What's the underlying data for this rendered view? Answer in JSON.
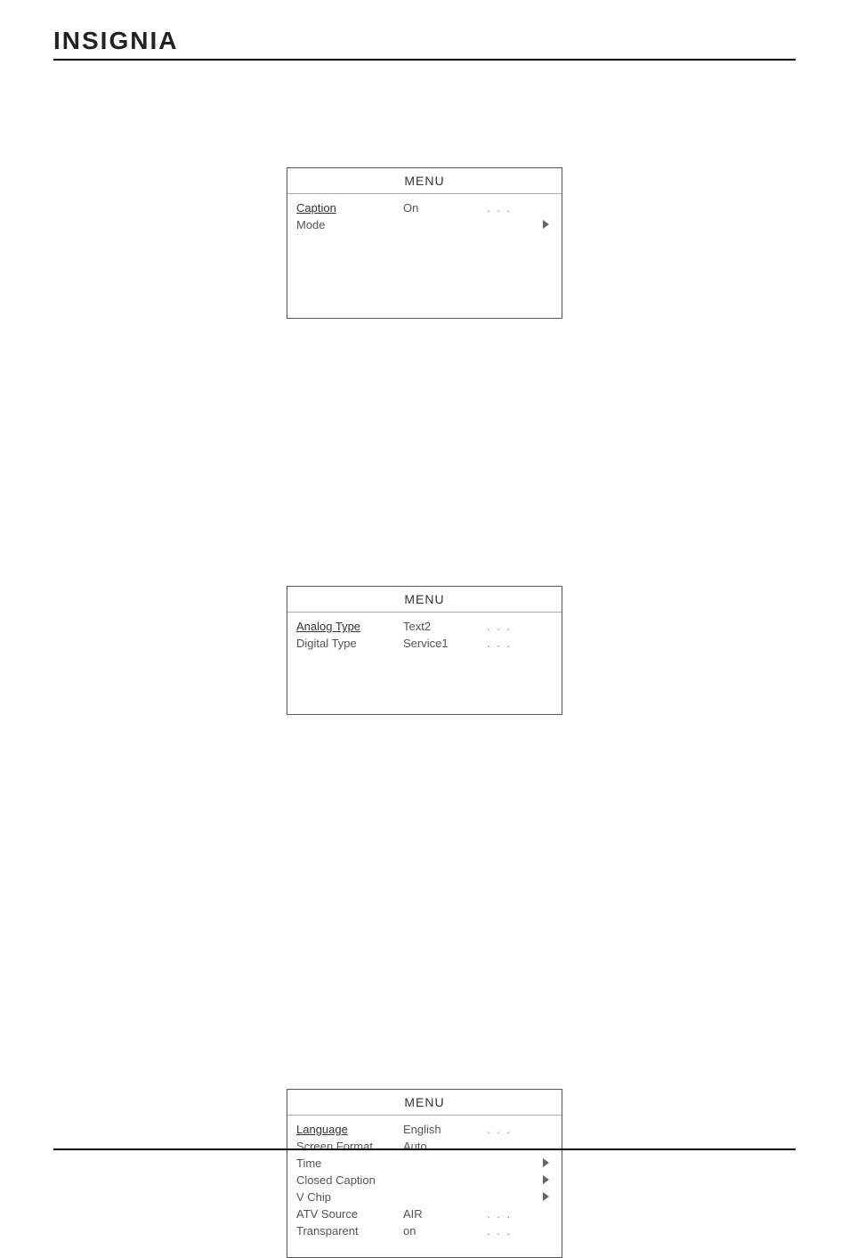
{
  "brand": "INSIGNIA",
  "menu1": {
    "title": "MENU",
    "rows": [
      {
        "label": "Caption",
        "value": "On",
        "dots": ". . .",
        "selected": true,
        "triangle": false
      },
      {
        "label": "Mode",
        "value": "",
        "dots": "",
        "selected": false,
        "triangle": true
      }
    ]
  },
  "menu2": {
    "title": "MENU",
    "rows": [
      {
        "label": "Analog Type",
        "value": "Text2",
        "dots": ". . .",
        "selected": true,
        "triangle": false
      },
      {
        "label": "Digital Type",
        "value": "Service1",
        "dots": ". . .",
        "selected": false,
        "triangle": false
      }
    ]
  },
  "menu3": {
    "title": "MENU",
    "rows": [
      {
        "label": "Language",
        "value": "English",
        "dots": ". . .",
        "selected": true,
        "triangle": false
      },
      {
        "label": "Screen Format",
        "value": "Auto",
        "dots": ". . .",
        "selected": false,
        "triangle": false
      },
      {
        "label": "Time",
        "value": "",
        "dots": "",
        "selected": false,
        "triangle": true
      },
      {
        "label": "Closed Caption",
        "value": "",
        "dots": "",
        "selected": false,
        "triangle": true
      },
      {
        "label": "V Chip",
        "value": "",
        "dots": "",
        "selected": false,
        "triangle": true
      },
      {
        "label": "ATV Source",
        "value": "AIR",
        "dots": ". . .",
        "selected": false,
        "triangle": false
      },
      {
        "label": "Transparent",
        "value": "on",
        "dots": ". . .",
        "selected": false,
        "triangle": false
      }
    ]
  }
}
